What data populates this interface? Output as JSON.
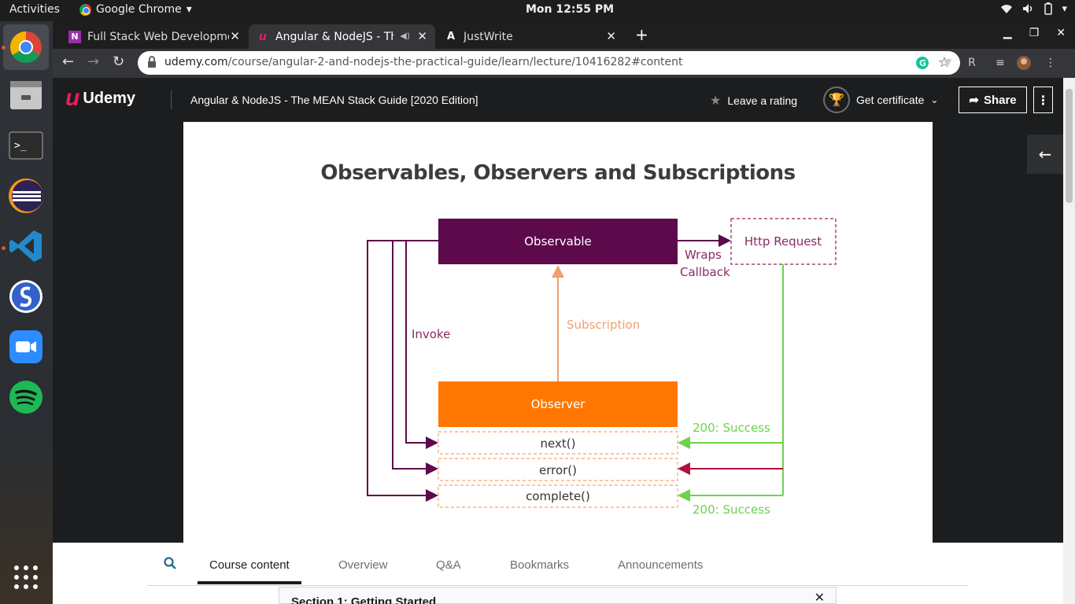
{
  "system": {
    "activities": "Activities",
    "app_menu": "Google Chrome",
    "clock": "Mon 12:55 PM"
  },
  "dock": {
    "apps": [
      "chrome",
      "files",
      "terminal",
      "eclipse",
      "vscode",
      "simplenote",
      "zoom",
      "spotify",
      "app-grid"
    ]
  },
  "browser": {
    "tabs": [
      {
        "title": "Full Stack Web Developme",
        "favicon": "N"
      },
      {
        "title": "Angular & NodeJS - Th",
        "favicon": "u"
      },
      {
        "title": "JustWrite",
        "favicon": "A"
      }
    ],
    "url_domain": "udemy.com",
    "url_path": "/course/angular-2-and-nodejs-the-practical-guide/learn/lecture/10416282#content"
  },
  "udemy": {
    "logo_text": "Udemy",
    "course_title": "Angular & NodeJS - The MEAN Stack Guide [2020 Edition]",
    "leave_rating": "Leave a rating",
    "get_certificate": "Get certificate",
    "share": "Share"
  },
  "slide": {
    "title": "Observables, Observers and Subscriptions",
    "observable": "Observable",
    "http_request": "Http Request",
    "wraps_callback_1": "Wraps",
    "wraps_callback_2": "Callback",
    "subscription": "Subscription",
    "invoke": "Invoke",
    "observer": "Observer",
    "next": "next()",
    "error": "error()",
    "complete": "complete()",
    "success_1": "200: Success",
    "success_2": "200: Success",
    "colors": {
      "observable": "#5c0a4b",
      "observer": "#ff7700",
      "success": "#6ad44a",
      "error": "#b0123a",
      "subscription": "#f0a070"
    }
  },
  "bottom_tabs": {
    "items": [
      "Course content",
      "Overview",
      "Q&A",
      "Bookmarks",
      "Announcements"
    ],
    "section_title": "Section 1: Getting Started"
  }
}
